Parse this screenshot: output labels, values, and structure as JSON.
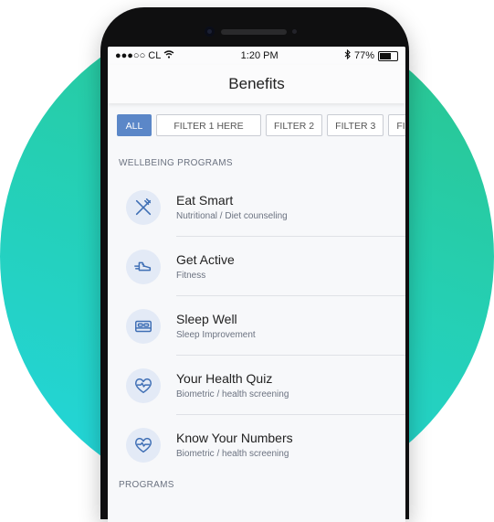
{
  "status_bar": {
    "carrier": "●●●○○ CL",
    "time": "1:20 PM",
    "battery": "77%",
    "battery_level": 0.77
  },
  "header": {
    "title": "Benefits"
  },
  "filters": [
    {
      "label": "ALL",
      "active": true
    },
    {
      "label": "FILTER 1 HERE"
    },
    {
      "label": "FILTER 2"
    },
    {
      "label": "FILTER 3"
    },
    {
      "label": "FIL"
    }
  ],
  "sections": {
    "wellbeing_label": "WELLBEING PROGRAMS",
    "next_label": "PROGRAMS"
  },
  "programs": [
    {
      "title": "Eat Smart",
      "subtitle": "Nutritional / Diet counseling",
      "icon": "fork-knife-icon"
    },
    {
      "title": "Get Active",
      "subtitle": "Fitness",
      "icon": "running-shoe-icon"
    },
    {
      "title": "Sleep Well",
      "subtitle": "Sleep Improvement",
      "icon": "bed-icon"
    },
    {
      "title": "Your Health Quiz",
      "subtitle": "Biometric / health screening",
      "icon": "heart-pulse-icon"
    },
    {
      "title": "Know Your Numbers",
      "subtitle": "Biometric / health screening",
      "icon": "heart-pulse-icon"
    }
  ],
  "colors": {
    "accent": "#5b87c8",
    "icon_bg": "#e3eaf6",
    "icon_stroke": "#3f6fb5",
    "gradient_start": "#2bc48a",
    "gradient_end": "#22d6e0"
  }
}
